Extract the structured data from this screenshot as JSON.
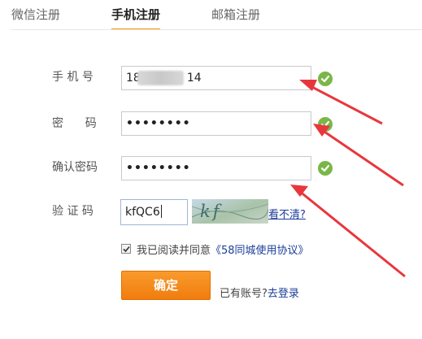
{
  "tabs": [
    {
      "label": "微信注册",
      "active": false
    },
    {
      "label": "手机注册",
      "active": true
    },
    {
      "label": "邮箱注册",
      "active": false
    }
  ],
  "form": {
    "phone": {
      "label": "手 机 号",
      "value_prefix": "18",
      "value_suffix": "14"
    },
    "password": {
      "label": "密      码",
      "value": "••••••••"
    },
    "confirm": {
      "label": "确认密码",
      "value": "••••••••"
    },
    "captcha": {
      "label": "验 证 码",
      "value": "kfQC6",
      "image_text": "kf QC6",
      "refresh_label": "看不清?"
    }
  },
  "agreement": {
    "checked": true,
    "text": "我已阅读并同意",
    "link": "《58同城使用协议》"
  },
  "submit_label": "确定",
  "login": {
    "prompt": "已有账号?",
    "link": "去登录"
  },
  "colors": {
    "accent": "#f39c12",
    "check_ok": "#7ab648",
    "link": "#1a3d99",
    "arrow": "#e8373c"
  },
  "icons": {
    "valid": "check-circle-icon"
  }
}
